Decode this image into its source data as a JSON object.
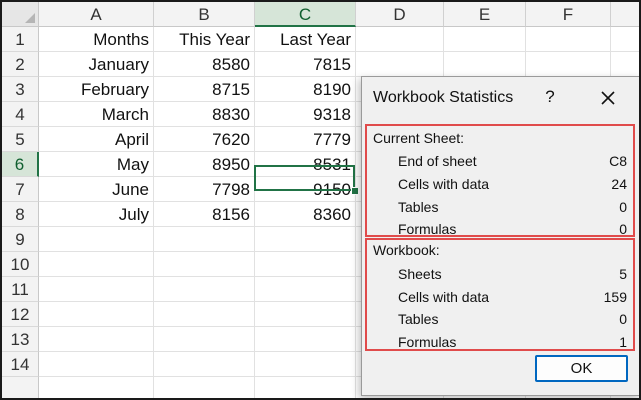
{
  "sheet": {
    "columns": [
      "A",
      "B",
      "C",
      "D",
      "E",
      "F"
    ],
    "selected_column": "C",
    "rows": [
      "1",
      "2",
      "3",
      "4",
      "5",
      "6",
      "7",
      "8",
      "9",
      "10",
      "11",
      "12",
      "13",
      "14"
    ],
    "selected_row": "6",
    "cells": [
      [
        "Months",
        "This Year",
        "Last Year"
      ],
      [
        "January",
        "8580",
        "7815"
      ],
      [
        "February",
        "8715",
        "8190"
      ],
      [
        "March",
        "8830",
        "9318"
      ],
      [
        "April",
        "7620",
        "7779"
      ],
      [
        "May",
        "8950",
        "8531"
      ],
      [
        "June",
        "7798",
        "9150"
      ],
      [
        "July",
        "8156",
        "8360"
      ]
    ],
    "active_cell": "C6",
    "colors": {
      "selection": "#217346",
      "header_selected_bg": "#d6e5d8"
    }
  },
  "dialog": {
    "title": "Workbook Statistics",
    "help": "?",
    "close_icon": "close-icon",
    "current_sheet": {
      "heading": "Current Sheet:",
      "stats": [
        {
          "label": "End of sheet",
          "value": "C8"
        },
        {
          "label": "Cells with data",
          "value": "24"
        },
        {
          "label": "Tables",
          "value": "0"
        },
        {
          "label": "Formulas",
          "value": "0"
        }
      ]
    },
    "workbook": {
      "heading": "Workbook:",
      "stats": [
        {
          "label": "Sheets",
          "value": "5"
        },
        {
          "label": "Cells with data",
          "value": "159"
        },
        {
          "label": "Tables",
          "value": "0"
        },
        {
          "label": "Formulas",
          "value": "1"
        }
      ]
    },
    "ok_label": "OK",
    "colors": {
      "highlight_border": "#e04b4b",
      "ok_border": "#0067c0"
    }
  }
}
